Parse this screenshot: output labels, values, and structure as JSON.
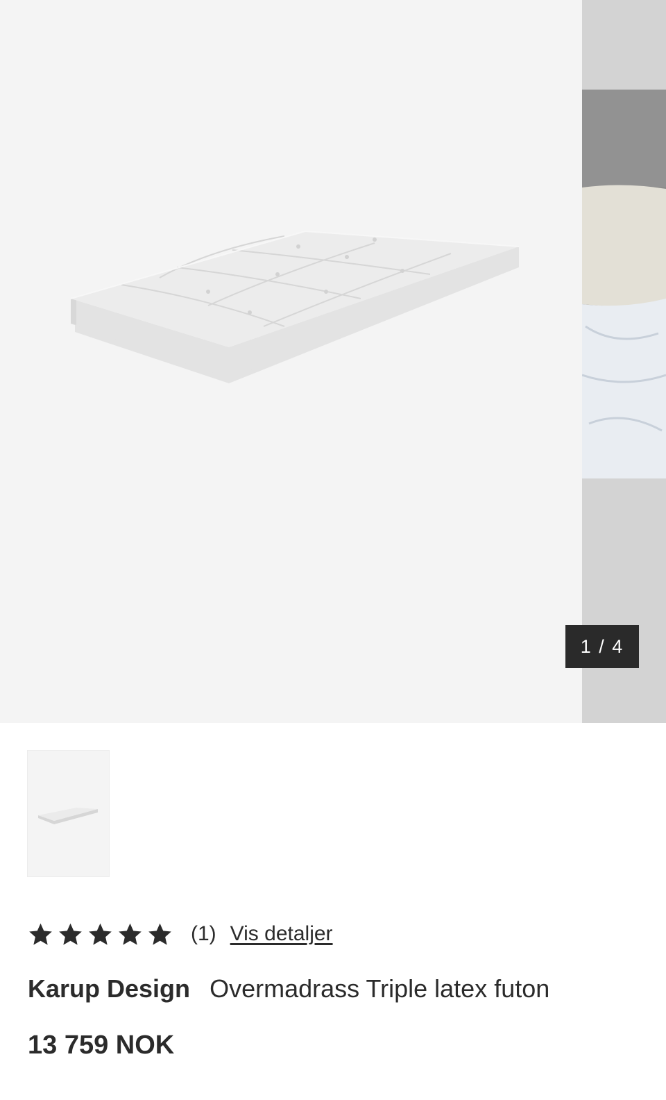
{
  "carousel": {
    "counter": {
      "current": "1",
      "separator": "/",
      "total": "4"
    },
    "colors": {
      "main_background": "#f4f4f4",
      "next_background": "#d3d3d3",
      "counter_background": "#2a2a2a"
    }
  },
  "product": {
    "rating": {
      "stars": 5,
      "max_stars": 5,
      "review_count": "(1)",
      "details_link": "Vis detaljer"
    },
    "brand": "Karup Design",
    "name": "Overmadrass Triple latex futon",
    "price": "13 759 NOK"
  }
}
